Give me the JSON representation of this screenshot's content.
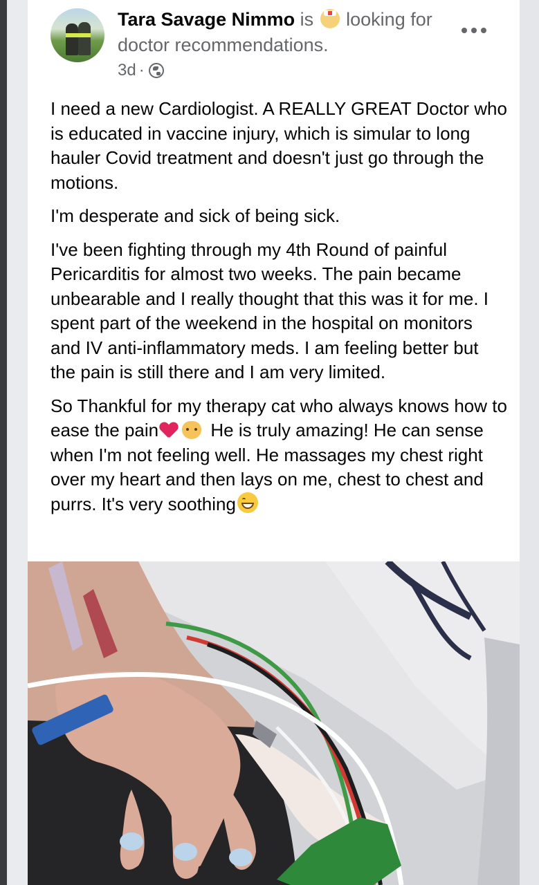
{
  "post": {
    "author": "Tara Savage Nimmo",
    "activity_prefix": "is",
    "activity_text": "looking for doctor recommendations.",
    "time": "3d",
    "separator": "·",
    "visibility_icon": "globe-icon",
    "more_icon": "more-dots-icon",
    "paragraphs": [
      "I need a new Cardiologist.  A REALLY GREAT Doctor who is  educated in  vaccine injury, which is simular to long hauler Covid treatment and doesn't just go through the motions.",
      "I'm desperate and sick of being sick.",
      "I've been fighting through my 4th Round of painful Pericarditis for almost two weeks.  The pain became unbearable and I really thought that this was it for me.  I spent part of the weekend in the hospital on monitors and IV anti-inflammatory meds. I am feeling better but the pain is still there and I am very limited."
    ],
    "p4_a": "So Thankful for my therapy cat who always knows how to ease the pain",
    "p4_b": " He is truly amazing! He can sense when I'm not feeling well. He massages my chest right over my heart and then lays on me, chest to chest and purrs. It's very soothing",
    "photo_icon": "hospital-photo"
  },
  "colors": {
    "text": "#050505",
    "secondary_text": "#65676b",
    "card": "#ffffff",
    "background": "#e9ebee"
  }
}
